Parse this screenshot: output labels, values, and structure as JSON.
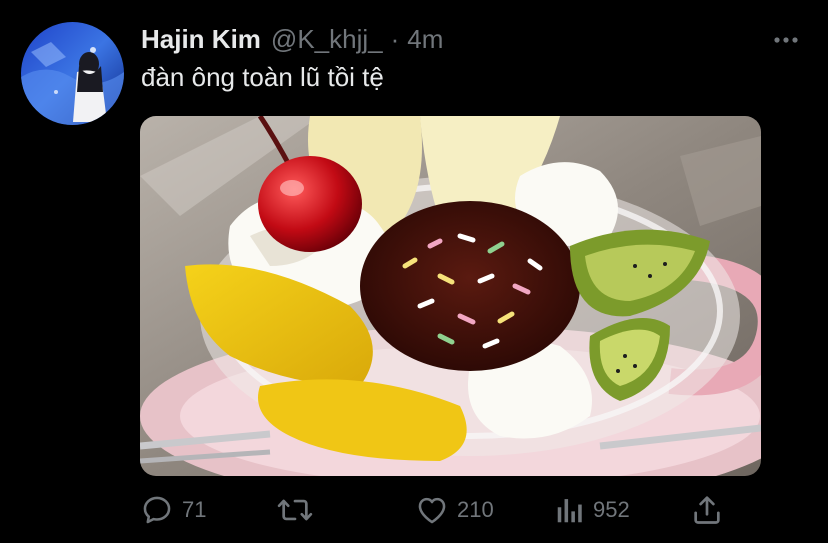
{
  "tweet": {
    "display_name": "Hajin Kim",
    "handle": "@K_khjj_",
    "separator": "·",
    "timestamp": "4m",
    "text": "đàn ông toàn lũ tồi tệ",
    "avatar_icon": "profile-avatar",
    "more_icon": "more-horizontal-icon",
    "media_description_icon": "photo"
  },
  "actions": {
    "reply": {
      "icon": "reply-icon",
      "count": "71"
    },
    "retweet": {
      "icon": "retweet-icon",
      "count": ""
    },
    "like": {
      "icon": "heart-icon",
      "count": "210"
    },
    "views": {
      "icon": "views-icon",
      "count": "952"
    },
    "share": {
      "icon": "share-icon",
      "count": ""
    }
  },
  "colors": {
    "background": "#000000",
    "primary_text": "#e7e9ea",
    "secondary_text": "#71767b"
  }
}
